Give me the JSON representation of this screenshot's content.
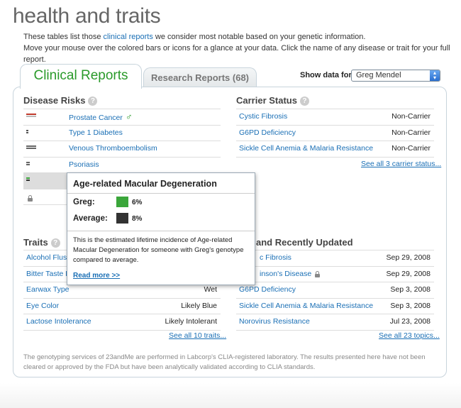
{
  "page_title": "health and traits",
  "intro": {
    "line1_pre": "These tables list those ",
    "line1_link": "clinical reports",
    "line1_post": " we consider most notable based on your genetic information.",
    "line2": "Move your mouse over the colored bars or icons for a glance at your data. Click the name of any disease or trait for your full report."
  },
  "tabs": {
    "clinical": "Clinical Reports",
    "research": "Research Reports (68)"
  },
  "show_data": {
    "label": "Show data for:",
    "selected": "Greg Mendel"
  },
  "disease_risks": {
    "title": "Disease Risks",
    "items": [
      {
        "label": "Prostate Cancer"
      },
      {
        "label": "Type 1 Diabetes"
      },
      {
        "label": "Venous Thromboembolism"
      },
      {
        "label": "Psoriasis"
      },
      {
        "label": ""
      },
      {
        "label": ""
      }
    ]
  },
  "carrier_status": {
    "title": "Carrier Status",
    "items": [
      {
        "label": "Cystic Fibrosis",
        "value": "Non-Carrier"
      },
      {
        "label": "G6PD Deficiency",
        "value": "Non-Carrier"
      },
      {
        "label": "Sickle Cell Anemia & Malaria Resistance",
        "value": "Non-Carrier"
      }
    ],
    "see_all": "See all 3 carrier status..."
  },
  "traits": {
    "title": "Traits",
    "items": [
      {
        "label": "Alcohol Flush",
        "value": ""
      },
      {
        "label": "Bitter Taste P",
        "value": ""
      },
      {
        "label": "Earwax Type",
        "value": "Wet"
      },
      {
        "label": "Eye Color",
        "value": "Likely Blue"
      },
      {
        "label": "Lactose Intolerance",
        "value": "Likely Intolerant"
      }
    ],
    "see_all": "See all 10 traits..."
  },
  "recent": {
    "title": "and Recently Updated",
    "items": [
      {
        "label": "c Fibrosis",
        "value": "Sep 29, 2008"
      },
      {
        "label": "inson's Disease",
        "value": "Sep 29, 2008"
      },
      {
        "label": "G6PD Deficiency",
        "value": "Sep 3, 2008"
      },
      {
        "label": "Sickle Cell Anemia & Malaria Resistance",
        "value": "Sep 3, 2008"
      },
      {
        "label": "Norovirus Resistance",
        "value": "Jul 23, 2008"
      }
    ],
    "see_all": "See all 23 topics..."
  },
  "tooltip": {
    "title": "Age-related Macular Degeneration",
    "greg_label": "Greg:",
    "greg_pct": "6%",
    "avg_label": "Average:",
    "avg_pct": "8%",
    "greg_color": "#3aa63a",
    "avg_color": "#333333",
    "description": "This is the estimated lifetime incidence of Age-related Macular Degeneration for someone with Greg's genotype compared to average.",
    "read_more": "Read more >>"
  },
  "disclaimer": "The genotyping services of 23andMe are performed in Labcorp's CLIA-registered laboratory. The results presented here have not been cleared or approved by the FDA but have been analytically validated according to CLIA standards.",
  "colors": {
    "link": "#1a6fb5",
    "accent_green": "#2a9a2a"
  }
}
